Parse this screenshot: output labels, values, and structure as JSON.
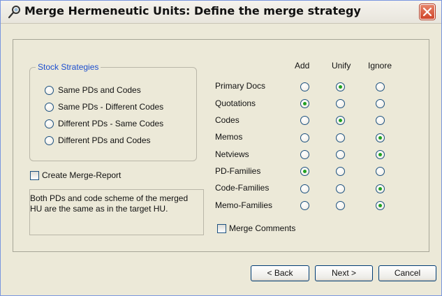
{
  "window": {
    "title": "Merge Hermeneutic Units: Define the merge strategy"
  },
  "stock_strategies": {
    "legend": "Stock Strategies",
    "options": [
      {
        "label": "Same PDs and Codes",
        "checked": true
      },
      {
        "label": "Same PDs - Different Codes",
        "checked": false
      },
      {
        "label": "Different PDs - Same Codes",
        "checked": false
      },
      {
        "label": "Different PDs and Codes",
        "checked": false
      }
    ]
  },
  "create_report": {
    "label": "Create Merge-Report",
    "checked": false
  },
  "description": "Both PDs and code scheme of the merged\nHU are the same as in the target HU.",
  "matrix": {
    "columns": [
      "Add",
      "Unify",
      "Ignore"
    ],
    "rows": [
      {
        "label": "Primary Docs",
        "selected": "Unify"
      },
      {
        "label": "Quotations",
        "selected": "Add"
      },
      {
        "label": "Codes",
        "selected": "Unify"
      },
      {
        "label": "Memos",
        "selected": "Ignore"
      },
      {
        "label": "Netviews",
        "selected": "Ignore"
      },
      {
        "label": "PD-Families",
        "selected": "Add"
      },
      {
        "label": "Code-Families",
        "selected": "Ignore"
      },
      {
        "label": "Memo-Families",
        "selected": "Ignore"
      }
    ]
  },
  "merge_comments": {
    "label": "Merge Comments",
    "checked": false
  },
  "buttons": {
    "back": "< Back",
    "next": "Next >",
    "cancel": "Cancel"
  },
  "colors": {
    "legend_text": "#1d4fcf",
    "radio_dot": "#21a121",
    "close_button": "#d0452a",
    "dialog_bg": "#ece9d8"
  }
}
